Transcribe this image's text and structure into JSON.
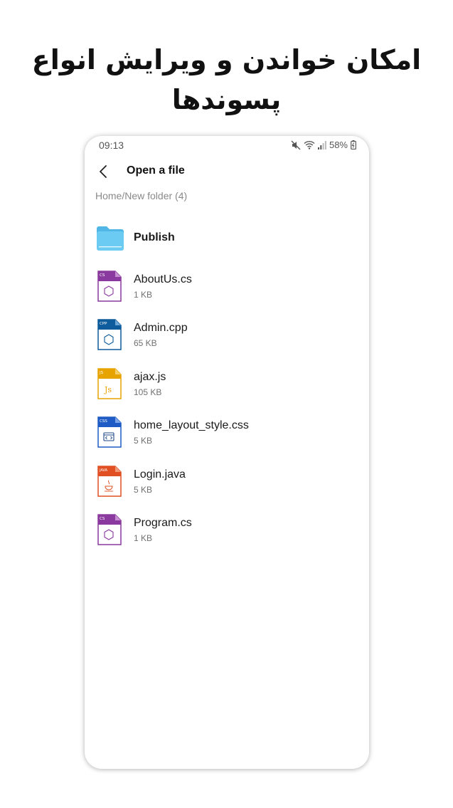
{
  "headline": {
    "line1": "امکان خواندن و ویرایش انواع",
    "line2": "پسوندها"
  },
  "status_bar": {
    "time": "09:13",
    "battery": "58%",
    "icons": [
      "mute-icon",
      "wifi-icon",
      "signal-icon",
      "battery-icon"
    ]
  },
  "app_bar": {
    "back_icon": "back-arrow-icon",
    "title": "Open a file"
  },
  "breadcrumb": "Home/New folder (4)",
  "colors": {
    "folder": "#5ec3ef",
    "cs": "#8a3a9e",
    "cpp": "#0f5c9c",
    "js": "#e7a400",
    "css": "#1f5bc4",
    "java": "#e05023"
  },
  "files": [
    {
      "name": "Publish",
      "size": "",
      "kind": "folder",
      "icon": "folder-icon",
      "tag": ""
    },
    {
      "name": "AboutUs.cs",
      "size": "1 KB",
      "kind": "cs",
      "icon": "cs-file-icon",
      "tag": "CS"
    },
    {
      "name": "Admin.cpp",
      "size": "65 KB",
      "kind": "cpp",
      "icon": "cpp-file-icon",
      "tag": "CPP"
    },
    {
      "name": "ajax.js",
      "size": "105 KB",
      "kind": "js",
      "icon": "js-file-icon",
      "tag": "JS"
    },
    {
      "name": "home_layout_style.css",
      "size": "5 KB",
      "kind": "css",
      "icon": "css-file-icon",
      "tag": "CSS"
    },
    {
      "name": "Login.java",
      "size": "5 KB",
      "kind": "java",
      "icon": "java-file-icon",
      "tag": "JAVA"
    },
    {
      "name": "Program.cs",
      "size": "1 KB",
      "kind": "cs",
      "icon": "cs-file-icon",
      "tag": "CS"
    }
  ]
}
